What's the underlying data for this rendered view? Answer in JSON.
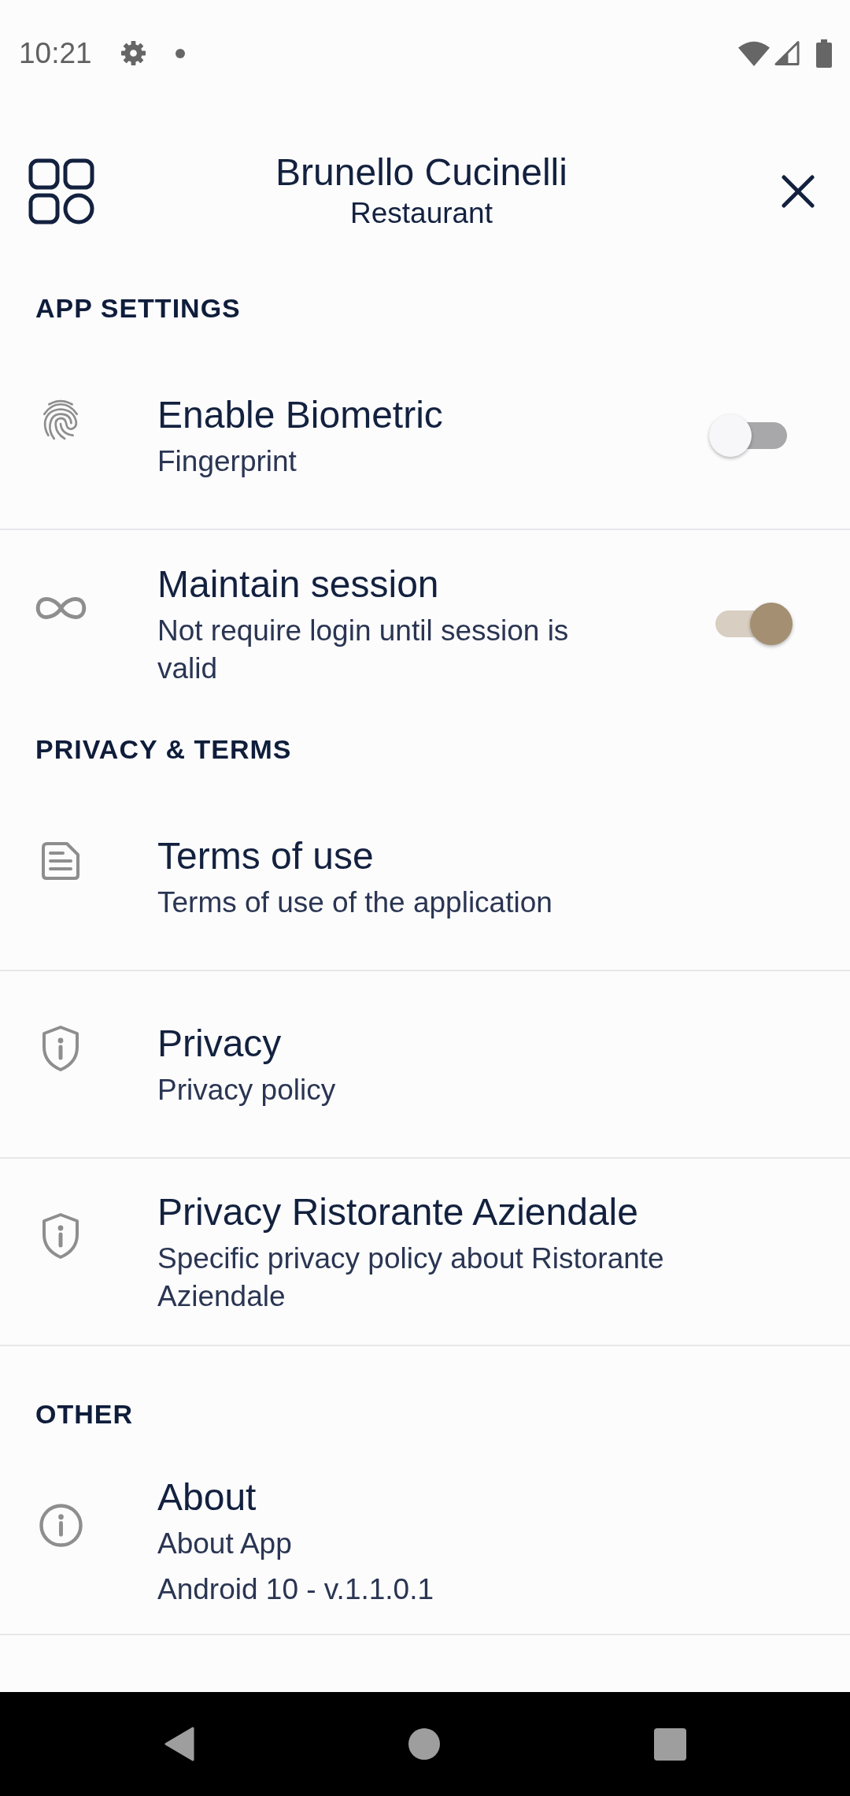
{
  "status_bar": {
    "time": "10:21"
  },
  "header": {
    "title": "Brunello Cucinelli",
    "subtitle": "Restaurant"
  },
  "sections": [
    {
      "heading": "APP SETTINGS",
      "items": [
        {
          "kind": "toggle",
          "title": "Enable Biometric",
          "subtitle": "Fingerprint",
          "on": false,
          "divider": true
        },
        {
          "kind": "toggle",
          "title": "Maintain session",
          "subtitle": "Not require login until session is valid",
          "on": true,
          "divider": false
        }
      ]
    },
    {
      "heading": "PRIVACY & TERMS",
      "items": [
        {
          "kind": "link",
          "title": "Terms of use",
          "subtitle": "Terms of use of the application",
          "divider": true
        },
        {
          "kind": "link",
          "title": "Privacy",
          "subtitle": "Privacy policy",
          "divider": true
        },
        {
          "kind": "link",
          "title": "Privacy Ristorante Aziendale",
          "subtitle": "Specific privacy policy about Ristorante Aziendale",
          "divider": true
        }
      ]
    },
    {
      "heading": "OTHER",
      "items": [
        {
          "kind": "link",
          "title": "About",
          "subtitle": "About App",
          "detail": "Android 10 - v.1.1.0.1",
          "divider": true
        }
      ]
    }
  ]
}
